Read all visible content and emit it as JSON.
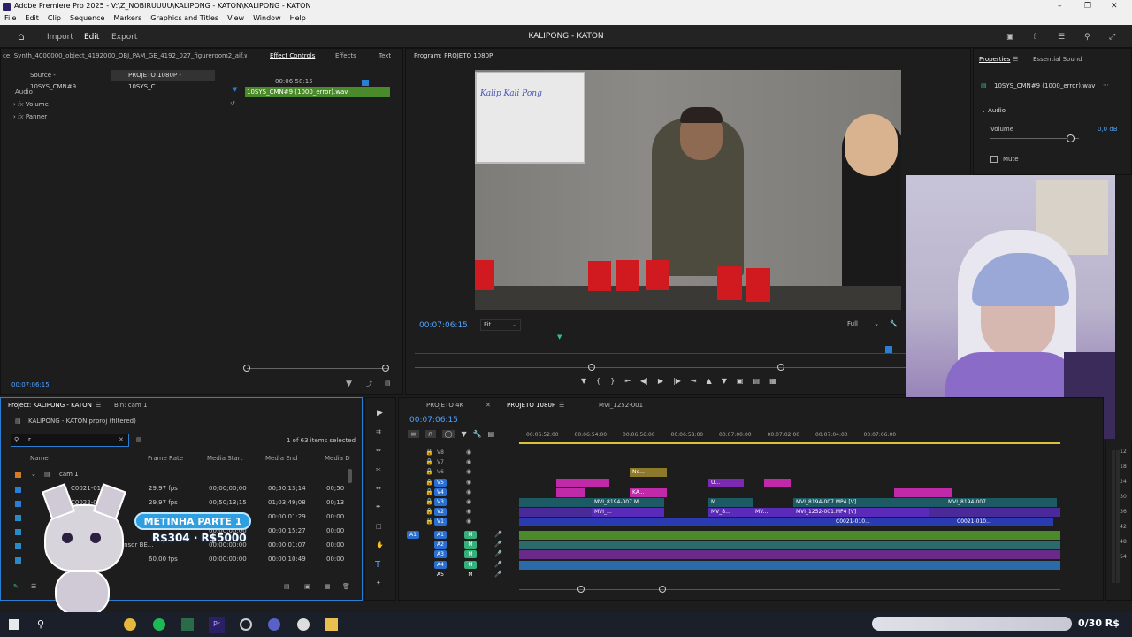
{
  "window": {
    "title": "Adobe Premiere Pro 2025 - V:\\Z_NOBIRUUUU\\KALIPONG - KATON\\KALIPONG - KATON"
  },
  "menu": [
    "File",
    "Edit",
    "Clip",
    "Sequence",
    "Markers",
    "Graphics and Titles",
    "View",
    "Window",
    "Help"
  ],
  "appbar": {
    "nav": [
      "Import",
      "Edit",
      "Export"
    ],
    "project_title": "KALIPONG - KATON"
  },
  "source_panel": {
    "path": "ce: Synth_4000000_object_4192000_OBJ_PAM_GE_4192_027_figureroom2_aif.wav",
    "tabs": [
      "Source - 10SYS_CMN#9...",
      "PROJETO 1080P - 10SYS_C..."
    ],
    "effect_tabs": [
      "Effect Controls",
      "Effects",
      "Text"
    ],
    "section": "Audio",
    "rows": [
      "Volume",
      "Panner"
    ],
    "timecode_ruler": "00:06:58:15",
    "clip_name": "10SYS_CMN#9 (1000_error).wav",
    "current_time": "00:07:06:15"
  },
  "program_monitor": {
    "title": "Program: PROJETO 1080P",
    "timecode": "00:07:06:15",
    "fit": "Fit",
    "quality": "Full",
    "whiteboard_text": "Kalip Kali Pong"
  },
  "properties": {
    "tabs": [
      "Properties",
      "Essential Sound"
    ],
    "clip": "10SYS_CMN#9 (1000_error).wav",
    "section": "Audio",
    "volume_label": "Volume",
    "volume_value": "0,0 dB",
    "mute_label": "Mute",
    "volume_level": 0.9
  },
  "project": {
    "tabs": [
      "Project: KALIPONG - KATON",
      "Bin: cam 1"
    ],
    "file": "KALIPONG - KATON.prproj (filtered)",
    "search_value": "r",
    "selection": "1 of 63 items selected",
    "columns": [
      "Name",
      "Frame Rate",
      "Media Start",
      "Media End",
      "Media D"
    ],
    "folder": "cam 1",
    "rows": [
      {
        "name": "C0021-0101...",
        "fr": "29,97 fps",
        "start": "00;00;00;00",
        "end": "00;50;13;14",
        "d": "00;50"
      },
      {
        "name": "C0022-0101...",
        "fr": "29,97 fps",
        "start": "00;50;13;15",
        "end": "01;03;49;08",
        "d": "00;13"
      },
      {
        "name": "Explosão...",
        "fr": "",
        "start": "00:00:00:00",
        "end": "00:00:01:29",
        "d": "00:00"
      },
      {
        "name": "Green Screen...",
        "fr": "",
        "start": "00:00:00:00",
        "end": "00:00:15:27",
        "d": "00:00"
      },
      {
        "name": "y2meta.com - Censor BE...",
        "fr": "",
        "start": "00:00:00:00",
        "end": "00:00:01:07",
        "d": "00:00"
      },
      {
        "name": "...",
        "fr": "60,00 fps",
        "start": "00:00:00:00",
        "end": "00:00:10:49",
        "d": "00:00"
      }
    ]
  },
  "timeline": {
    "tabs": [
      "PROJETO 4K",
      "PROJETO 1080P",
      "MVI_1252-001"
    ],
    "timecode": "00:07:06:15",
    "ruler": [
      "00:06:52:00",
      "00:06:54:00",
      "00:06:56:00",
      "00:06:58:00",
      "00:07:00:00",
      "00:07:02:00",
      "00:07:04:00",
      "00:07:06:00"
    ],
    "video_tracks": [
      "V8",
      "V7",
      "V6",
      "V5",
      "V4",
      "V3",
      "V2",
      "V1"
    ],
    "audio_tracks": [
      "A1",
      "A2",
      "A3",
      "A4",
      "A5"
    ],
    "clips": [
      "Ne...",
      "KA...",
      "U...",
      "MVI_8194-007.M...",
      "M...",
      "MV_8...",
      "MVI_8194-007.MP4 [V]",
      "MVI_8194-007...",
      "MVI_...",
      "MV...",
      "MVI_1252-001.MP4 [V]",
      "C...",
      "C0021-010...",
      "C0021-010...",
      "C0021-010..."
    ],
    "meter_labels": [
      "-12",
      "-18",
      "-24",
      "-30",
      "-36",
      "-42",
      "-48",
      "-54"
    ]
  },
  "stream_overlay": {
    "goal_title": "METINHA PARTE 1",
    "goal_amount": "R$304 · R$5000",
    "bar_text": "0/30 R$"
  }
}
